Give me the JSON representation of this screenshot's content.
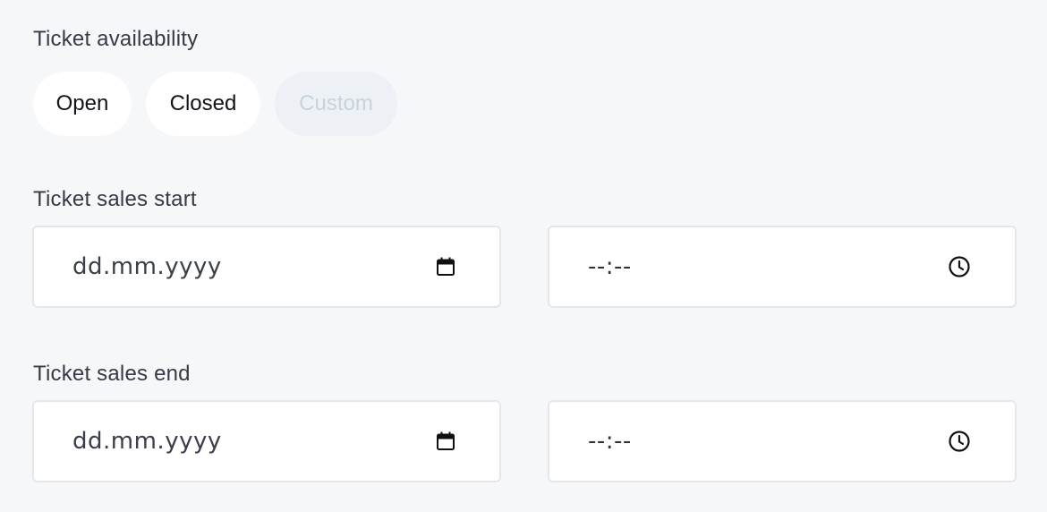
{
  "availability": {
    "label": "Ticket availability",
    "options": [
      {
        "label": "Open",
        "state": "enabled"
      },
      {
        "label": "Closed",
        "state": "enabled"
      },
      {
        "label": "Custom",
        "state": "disabled"
      }
    ]
  },
  "sales_start": {
    "label": "Ticket sales start",
    "date_placeholder": "dd.mm.yyyy",
    "time_placeholder": "--:--",
    "date_icon": "calendar-icon",
    "time_icon": "clock-icon"
  },
  "sales_end": {
    "label": "Ticket sales end",
    "date_placeholder": "dd.mm.yyyy",
    "time_placeholder": "--:--",
    "date_icon": "calendar-icon",
    "time_icon": "clock-icon"
  },
  "colors": {
    "background": "#f6f7f9",
    "pill_background": "#ffffff",
    "pill_disabled_background": "#edf1f5",
    "pill_disabled_text": "#c6d2dd",
    "field_border": "#e3e6ea"
  }
}
